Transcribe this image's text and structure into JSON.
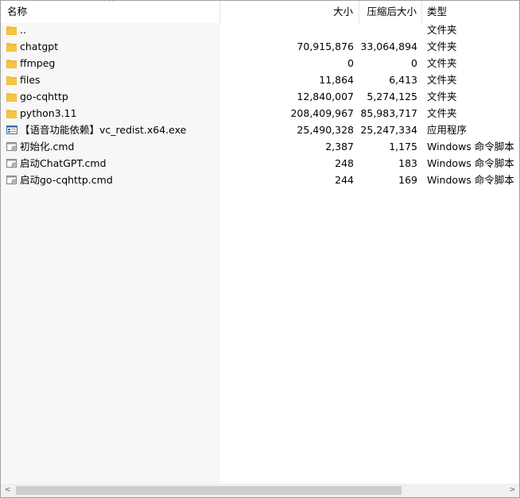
{
  "header": {
    "name": "名称",
    "size": "大小",
    "packed": "压缩后大小",
    "type": "类型",
    "sort_indicator": "^"
  },
  "files": [
    {
      "name": "..",
      "size": "",
      "packed": "",
      "type": "文件夹",
      "icon": "folder-icon"
    },
    {
      "name": "chatgpt",
      "size": "70,915,876",
      "packed": "33,064,894",
      "type": "文件夹",
      "icon": "folder-icon"
    },
    {
      "name": "ffmpeg",
      "size": "0",
      "packed": "0",
      "type": "文件夹",
      "icon": "folder-icon"
    },
    {
      "name": "files",
      "size": "11,864",
      "packed": "6,413",
      "type": "文件夹",
      "icon": "folder-icon"
    },
    {
      "name": "go-cqhttp",
      "size": "12,840,007",
      "packed": "5,274,125",
      "type": "文件夹",
      "icon": "folder-icon"
    },
    {
      "name": "python3.11",
      "size": "208,409,967",
      "packed": "85,983,717",
      "type": "文件夹",
      "icon": "folder-icon"
    },
    {
      "name": "【语音功能依赖】vc_redist.x64.exe",
      "size": "25,490,328",
      "packed": "25,247,334",
      "type": "应用程序",
      "icon": "exe-icon"
    },
    {
      "name": "初始化.cmd",
      "size": "2,387",
      "packed": "1,175",
      "type": "Windows 命令脚本",
      "icon": "cmd-icon"
    },
    {
      "name": "启动ChatGPT.cmd",
      "size": "248",
      "packed": "183",
      "type": "Windows 命令脚本",
      "icon": "cmd-icon"
    },
    {
      "name": "启动go-cqhttp.cmd",
      "size": "244",
      "packed": "169",
      "type": "Windows 命令脚本",
      "icon": "cmd-icon"
    }
  ],
  "scrollbar": {
    "left_arrow": "<",
    "right_arrow": ">",
    "thumb_fraction": 0.79
  },
  "colors": {
    "folder": "#f5c542",
    "folder_dark": "#dca72a",
    "name_column_bg": "#f7f7f7"
  }
}
